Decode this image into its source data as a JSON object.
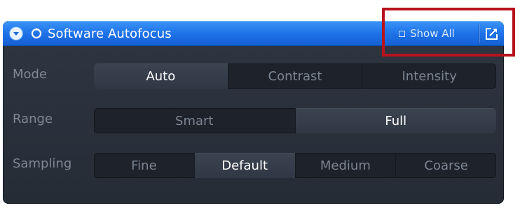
{
  "panel": {
    "title": "Software Autofocus",
    "show_all_label": "Show All"
  },
  "icons": {
    "collapse": "chevron-down-icon",
    "refresh": "refresh-icon",
    "popout": "popout-icon"
  },
  "colors": {
    "title_bar": "#1d70e6",
    "panel_bg": "#2b313b",
    "highlight": "#b8131c"
  },
  "rows": [
    {
      "label": "Mode",
      "options": [
        "Auto",
        "Contrast",
        "Intensity"
      ],
      "selected": "Auto"
    },
    {
      "label": "Range",
      "options": [
        "Smart",
        "Full"
      ],
      "selected": "Full"
    },
    {
      "label": "Sampling",
      "options": [
        "Fine",
        "Default",
        "Medium",
        "Coarse"
      ],
      "selected": "Default"
    }
  ]
}
